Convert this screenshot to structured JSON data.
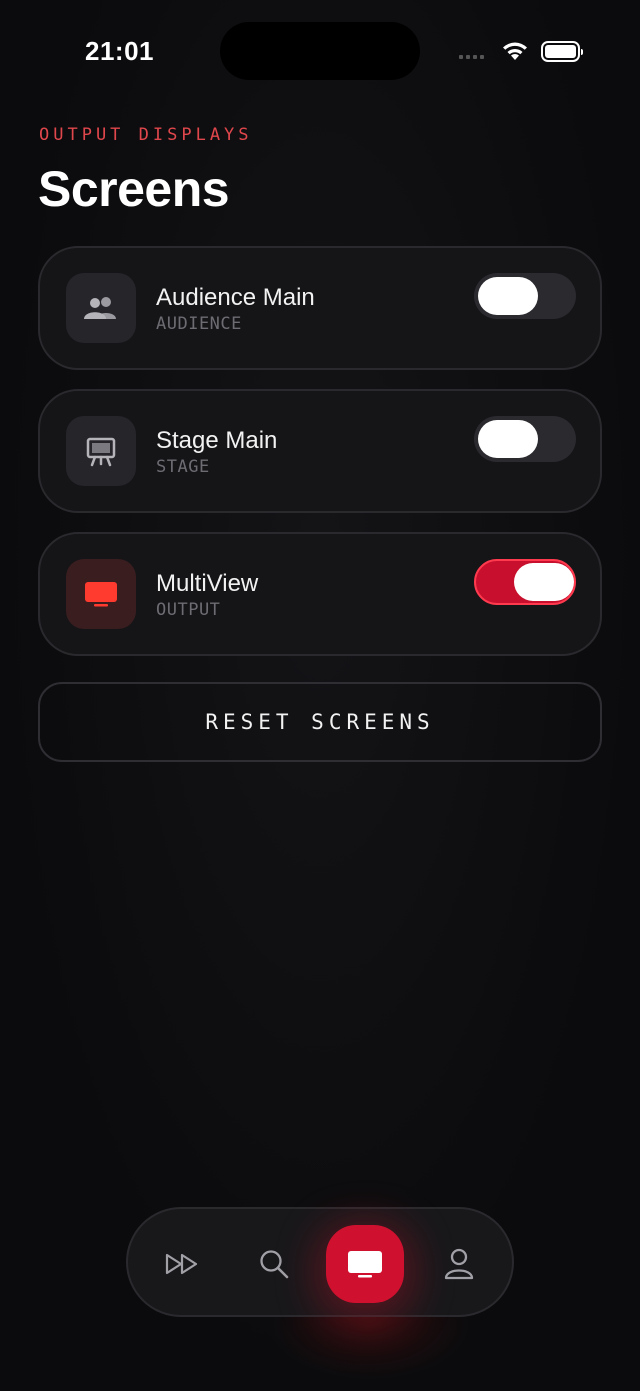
{
  "status_bar": {
    "time": "21:01"
  },
  "header": {
    "eyebrow": "OUTPUT DISPLAYS",
    "title": "Screens"
  },
  "screens": [
    {
      "name": "Audience Main",
      "kind": "AUDIENCE",
      "enabled": false,
      "icon": "people-icon"
    },
    {
      "name": "Stage Main",
      "kind": "STAGE",
      "enabled": false,
      "icon": "easel-icon"
    },
    {
      "name": "MultiView",
      "kind": "OUTPUT",
      "enabled": true,
      "icon": "monitor-icon"
    }
  ],
  "reset_button": {
    "label": "RESET SCREENS"
  },
  "tabbar": {
    "items": [
      {
        "icon": "fast-forward-icon",
        "active": false
      },
      {
        "icon": "search-icon",
        "active": false
      },
      {
        "icon": "screen-icon",
        "active": true
      },
      {
        "icon": "person-icon",
        "active": false
      }
    ]
  },
  "colors": {
    "accent": "#c8102e",
    "eyebrow": "#e0474c",
    "card_bg": "#151518"
  }
}
